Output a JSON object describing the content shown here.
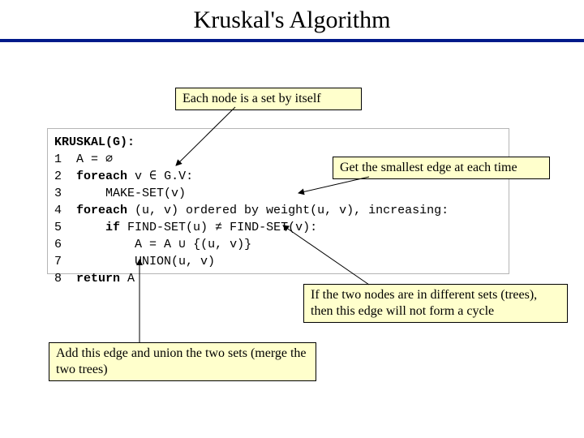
{
  "title": "Kruskal's Algorithm",
  "notes": {
    "n1": "Each node is a set by itself",
    "n2": "Get the smallest edge at each time",
    "n3": "If the two nodes are in different sets (trees), then this edge will not form a cycle",
    "n4": "Add this edge and union the two sets (merge the two trees)"
  },
  "pseudocode": {
    "header": "KRUSKAL(G):",
    "l1p1": "1  A = ",
    "l1sym": "∅",
    "l2p1": "2  ",
    "l2kw": "foreach",
    "l2p2": " v ",
    "l2sym": "∈",
    "l2p3": " G.V:",
    "l3": "3      MAKE-SET(v)",
    "l4p1": "4  ",
    "l4kw": "foreach",
    "l4p2": " (u, v) ordered by weight(u, v), increasing:",
    "l5p1": "5      ",
    "l5kw": "if",
    "l5p2": " FIND-SET(u) ",
    "l5sym": "≠",
    "l5p3": " FIND-SET(v):",
    "l6p1": "6          A = A ",
    "l6sym": "∪",
    "l6p2": " {(u, v)}",
    "l7": "7          UNION(u, v)",
    "l8p1": "8  ",
    "l8kw": "return",
    "l8p2": " A"
  }
}
